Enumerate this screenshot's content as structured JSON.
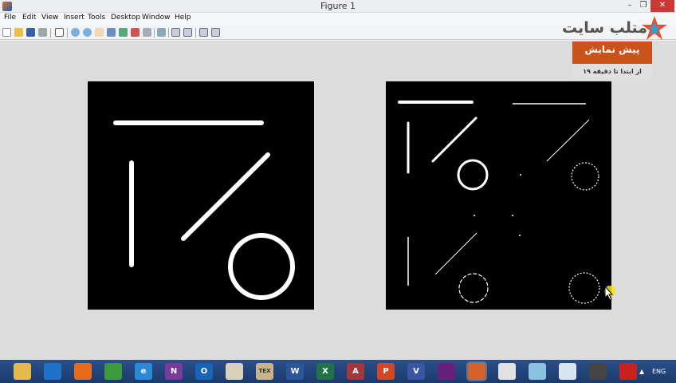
{
  "window": {
    "title": "Figure 1",
    "minimize": "–",
    "maximize": "❐",
    "close": "✕"
  },
  "menu": [
    "File",
    "Edit",
    "View",
    "Insert",
    "Tools",
    "Desktop",
    "Window",
    "Help"
  ],
  "toolbar": [
    "new-figure-icon",
    "open-icon",
    "save-icon",
    "print-icon",
    "pointer-icon",
    "zoom-in-icon",
    "zoom-out-icon",
    "pan-icon",
    "rotate-icon",
    "data-cursor-icon",
    "brush-icon",
    "link-icon",
    "colorbar-icon",
    "legend-icon",
    "hide-plot-tools-icon",
    "show-plot-tools-icon"
  ],
  "watermark": {
    "logo_text": "متلب سایت",
    "preview_title": "پیش نمایش",
    "preview_subtitle": "از ابتدا تا دقیقه ۱۹"
  },
  "taskbar": {
    "apps": [
      {
        "name": "file-explorer",
        "label": "",
        "color": "#e6b84a"
      },
      {
        "name": "onedrive",
        "label": "",
        "color": "#1e73c8"
      },
      {
        "name": "firefox",
        "label": "",
        "color": "#e76b1b"
      },
      {
        "name": "chrome",
        "label": "",
        "color": "#3c9a3c"
      },
      {
        "name": "internet-explorer",
        "label": "e",
        "color": "#2a8ad8"
      },
      {
        "name": "onenote",
        "label": "N",
        "color": "#7a3a9a"
      },
      {
        "name": "outlook",
        "label": "O",
        "color": "#1a64b5"
      },
      {
        "name": "pen-tool",
        "label": "",
        "color": "#d8d0b8"
      },
      {
        "name": "tex",
        "label": "TEX",
        "color": "#c9b48a"
      },
      {
        "name": "word",
        "label": "W",
        "color": "#2b579a"
      },
      {
        "name": "excel",
        "label": "X",
        "color": "#217346"
      },
      {
        "name": "access",
        "label": "A",
        "color": "#a4373a"
      },
      {
        "name": "powerpoint",
        "label": "P",
        "color": "#d24726"
      },
      {
        "name": "visio",
        "label": "V",
        "color": "#3955a3"
      },
      {
        "name": "visual-studio",
        "label": "",
        "color": "#68217a"
      },
      {
        "name": "matlab",
        "label": "",
        "color": "#d4622a"
      },
      {
        "name": "chart-app",
        "label": "",
        "color": "#e2e2e2"
      },
      {
        "name": "notes",
        "label": "",
        "color": "#8ac0e0"
      },
      {
        "name": "document",
        "label": "",
        "color": "#d8e4f0"
      },
      {
        "name": "terminal",
        "label": "",
        "color": "#444444"
      },
      {
        "name": "acrobat",
        "label": "",
        "color": "#c9211e"
      }
    ],
    "tray_arrow": "▲",
    "language": "ENG"
  }
}
